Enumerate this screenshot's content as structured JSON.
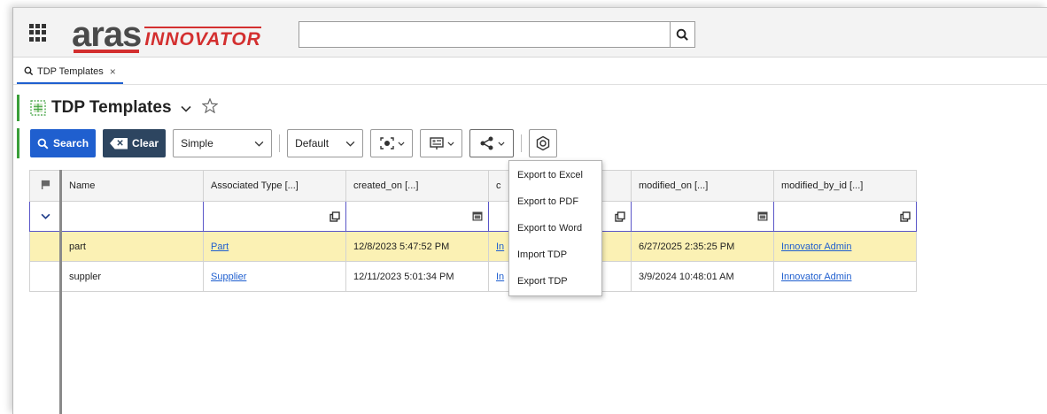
{
  "header": {
    "logo_main": "aras",
    "logo_sub": "INNOVATOR",
    "search_value": ""
  },
  "tabs": [
    {
      "label": "TDP Templates"
    }
  ],
  "page": {
    "title": "TDP Templates"
  },
  "toolbar": {
    "search_label": "Search",
    "clear_label": "Clear",
    "mode_value": "Simple",
    "layout_value": "Default"
  },
  "grid": {
    "columns": [
      "Name",
      "Associated Type [...]",
      "created_on [...]",
      "c",
      "modified_on [...]",
      "modified_by_id [...]"
    ],
    "rows": [
      {
        "name": "part",
        "associated_type": "Part",
        "created_on": "12/8/2023 5:47:52 PM",
        "c": "In",
        "modified_on": "6/27/2025 2:35:25 PM",
        "modified_by": "Innovator Admin"
      },
      {
        "name": "suppler",
        "associated_type": "Supplier",
        "created_on": "12/11/2023 5:01:34 PM",
        "c": "In",
        "modified_on": "3/9/2024 10:48:01 AM",
        "modified_by": "Innovator Admin"
      }
    ]
  },
  "share_menu": {
    "items": [
      "Export to Excel",
      "Export to PDF",
      "Export to Word",
      "Import TDP",
      "Export TDP"
    ]
  },
  "colors": {
    "accent_blue": "#1f5fcf",
    "clear_button": "#2d4560",
    "row_highlight": "#fbf1b4",
    "filter_border": "#5a56c8",
    "brand_red": "#d32f2f",
    "title_accent": "#3a9f3a"
  }
}
